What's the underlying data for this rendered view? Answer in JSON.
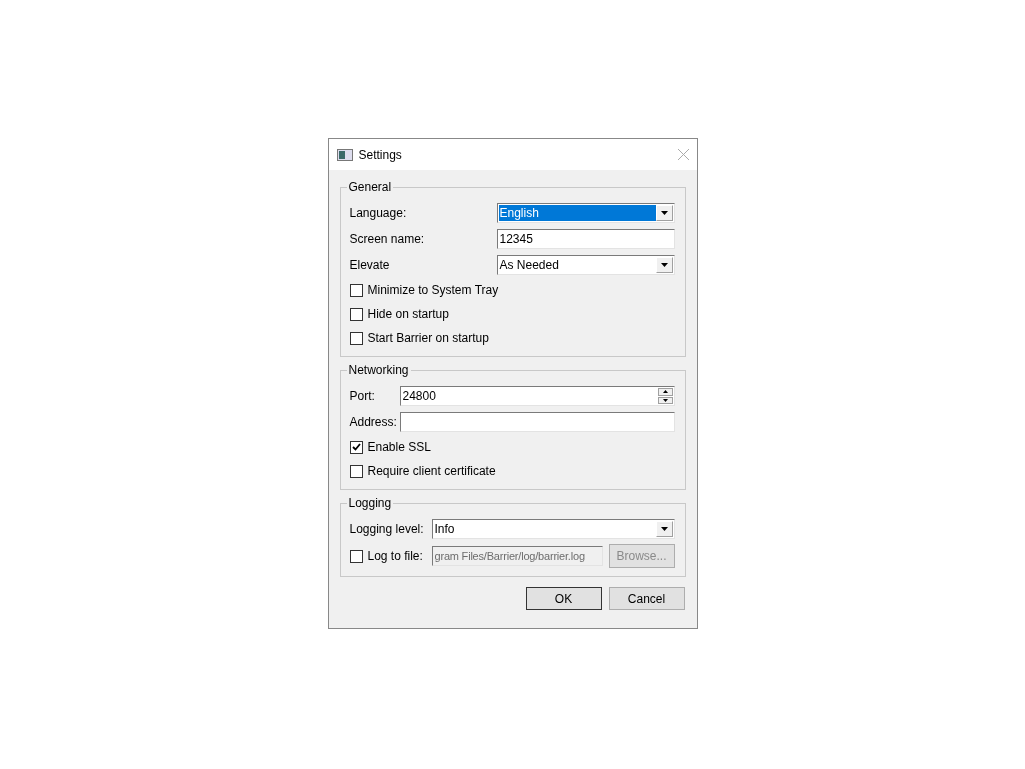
{
  "window": {
    "title": "Settings"
  },
  "sections": [
    {
      "title": "General",
      "rows": [
        {
          "kind": "combo",
          "label": "Language:",
          "value": "English",
          "highlighted": true
        },
        {
          "kind": "text",
          "label": "Screen name:",
          "value": "12345"
        },
        {
          "kind": "combo",
          "label": "Elevate",
          "value": "As Needed",
          "highlighted": false
        },
        {
          "kind": "checkbox",
          "label": "Minimize to System Tray",
          "checked": false
        },
        {
          "kind": "checkbox",
          "label": "Hide on startup",
          "checked": false
        },
        {
          "kind": "checkbox",
          "label": "Start Barrier on startup",
          "checked": false
        }
      ]
    },
    {
      "title": "Networking",
      "rows": [
        {
          "kind": "spin",
          "label": "Port:",
          "value": "24800"
        },
        {
          "kind": "text",
          "label": "Address:"
        },
        {
          "kind": "checkbox",
          "label": "Enable SSL",
          "checked": true
        },
        {
          "kind": "checkbox",
          "label": "Require client certificate",
          "checked": false
        }
      ]
    },
    {
      "title": "Logging",
      "rows": [
        {
          "kind": "combo",
          "label": "Logging level:",
          "value": "Info",
          "highlighted": false
        },
        {
          "kind": "file",
          "label": "Log to file:",
          "checked": false,
          "path": "gram Files/Barrier/log/barrier.log",
          "button": "Browse...",
          "disabled": true
        }
      ]
    }
  ],
  "buttons": [
    {
      "label": "OK",
      "default": true
    },
    {
      "label": "Cancel",
      "default": false
    }
  ]
}
